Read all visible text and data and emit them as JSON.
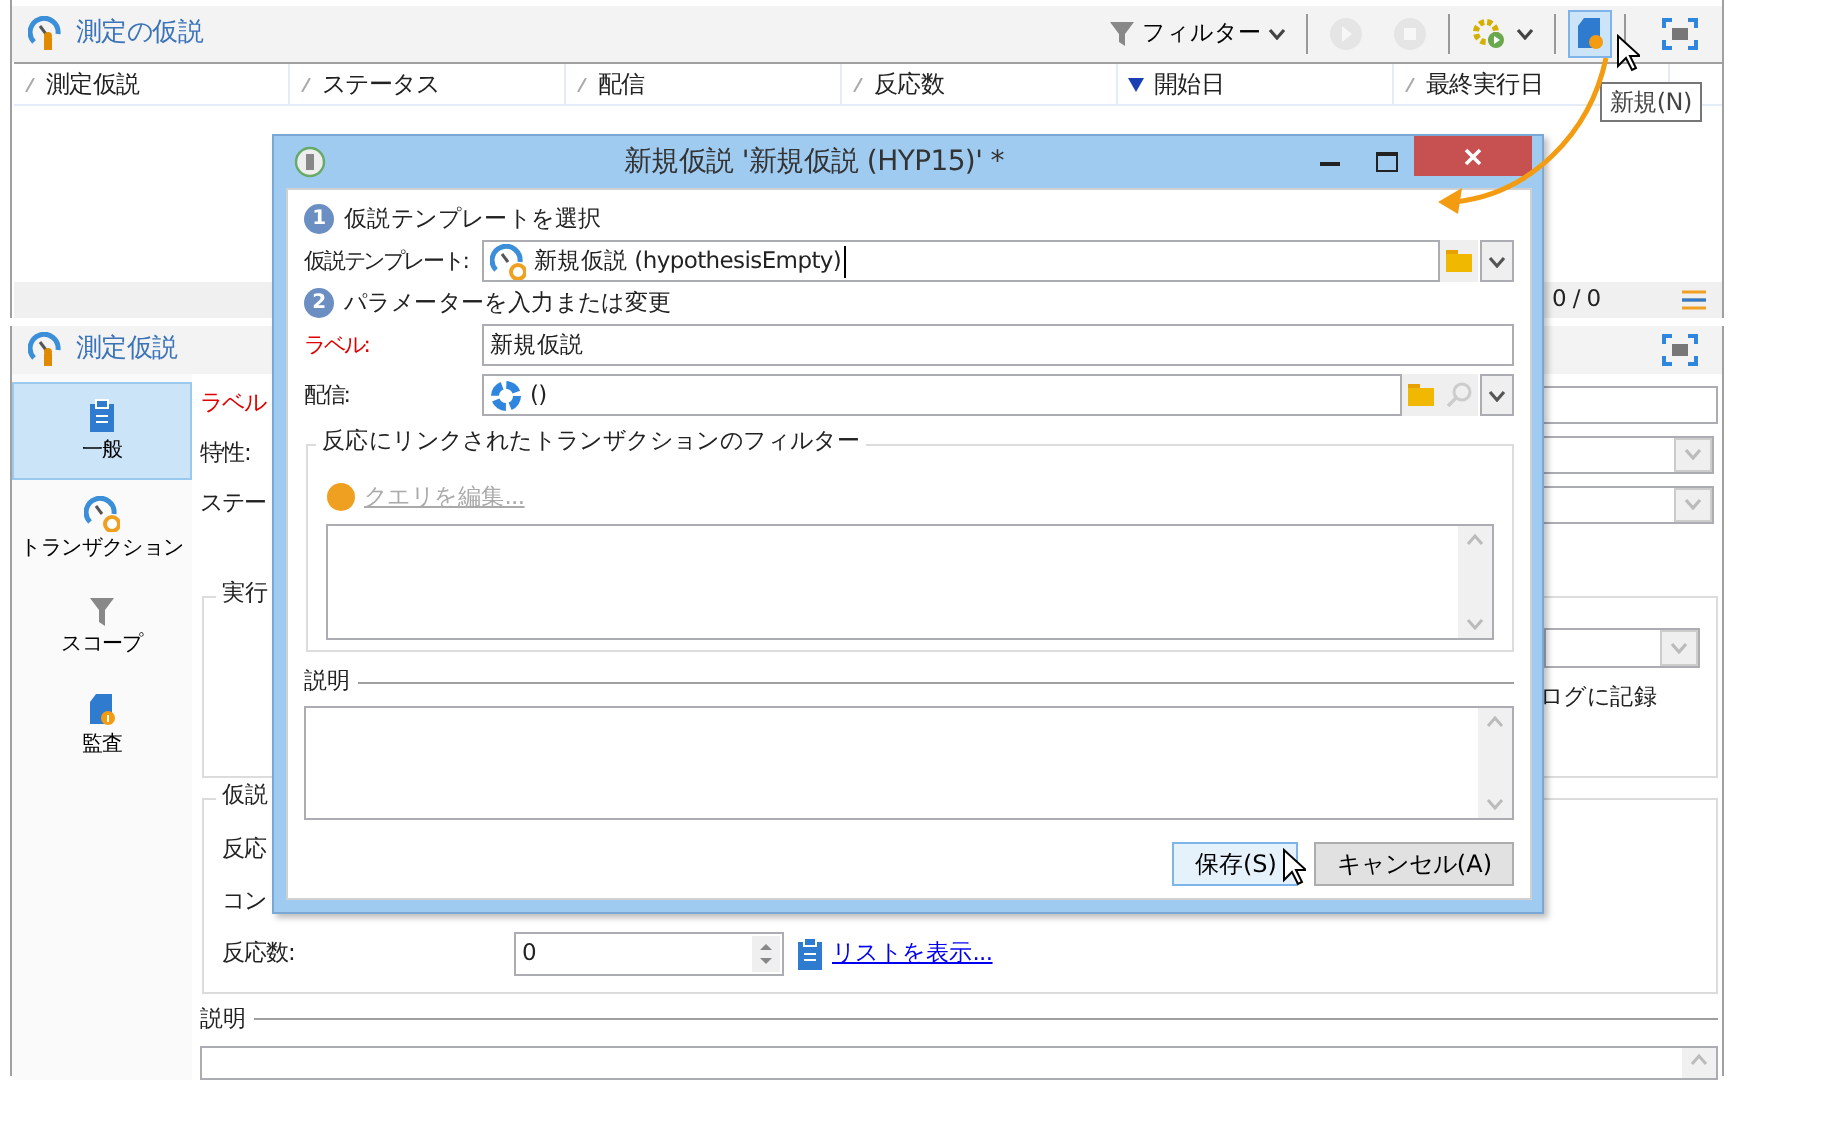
{
  "list_panel": {
    "title": "測定の仮説",
    "toolbar": [
      {
        "kind": "filter",
        "label": "フィルター",
        "disabled": false,
        "hovered": false
      },
      {
        "kind": "play",
        "disabled": true,
        "hovered": false
      },
      {
        "kind": "stop",
        "disabled": true,
        "hovered": false
      },
      {
        "kind": "workflow",
        "disabled": false,
        "hovered": false
      },
      {
        "kind": "new",
        "disabled": false,
        "hovered": true
      },
      {
        "kind": "maximize",
        "disabled": false,
        "hovered": false
      }
    ],
    "tooltip": "新規(N)",
    "columns": [
      {
        "label": "測定仮説",
        "sorted": false
      },
      {
        "label": "ステータス",
        "sorted": false
      },
      {
        "label": "配信",
        "sorted": false
      },
      {
        "label": "反応数",
        "sorted": false
      },
      {
        "label": "開始日",
        "sorted": true
      },
      {
        "label": "最終実行日",
        "sorted": false
      }
    ],
    "count": "0 / 0"
  },
  "detail_panel": {
    "title": "測定仮説",
    "sidebar": [
      {
        "kind": "general",
        "label": "一般",
        "selected": true
      },
      {
        "kind": "transaction",
        "label": "トランザクション",
        "selected": false
      },
      {
        "kind": "scope",
        "label": "スコープ",
        "selected": false
      },
      {
        "kind": "audit",
        "label": "監査",
        "selected": false
      }
    ],
    "rows": [
      {
        "label": "ラベル",
        "required": true,
        "kind": "text"
      },
      {
        "label": "特性:",
        "required": false,
        "kind": "select"
      },
      {
        "label": "ステー",
        "required": false,
        "kind": "select"
      }
    ],
    "execution_group": {
      "title": "実行",
      "log_label": "ログに記録"
    },
    "hypothesis_group": {
      "title": "仮説",
      "rows": [
        {
          "label": "反応"
        },
        {
          "label": "コン"
        },
        {
          "label": "反応数:",
          "value": "0",
          "link": "リストを表示..."
        }
      ]
    },
    "description": {
      "title": "説明"
    }
  },
  "dialog": {
    "title": "新規仮説 '新規仮説 (HYP15)' *",
    "steps": [
      {
        "number": "1",
        "label": "仮説テンプレートを選択"
      },
      {
        "number": "2",
        "label": "パラメーターを入力または変更"
      }
    ],
    "template": {
      "label": "仮説テンプレート:",
      "value": "新規仮説 (hypothesisEmpty)"
    },
    "label_field": {
      "label": "ラベル:",
      "required": true,
      "value": "新規仮説"
    },
    "delivery": {
      "label": "配信:",
      "value": "()"
    },
    "filter_group": {
      "title": "反応にリンクされたトランザクションのフィルター",
      "link": "クエリを編集...",
      "link_disabled": true
    },
    "description": {
      "title": "説明"
    },
    "buttons": [
      {
        "label": "保存(S)",
        "focused": true
      },
      {
        "label": "キャンセル(A)",
        "focused": false
      }
    ]
  }
}
